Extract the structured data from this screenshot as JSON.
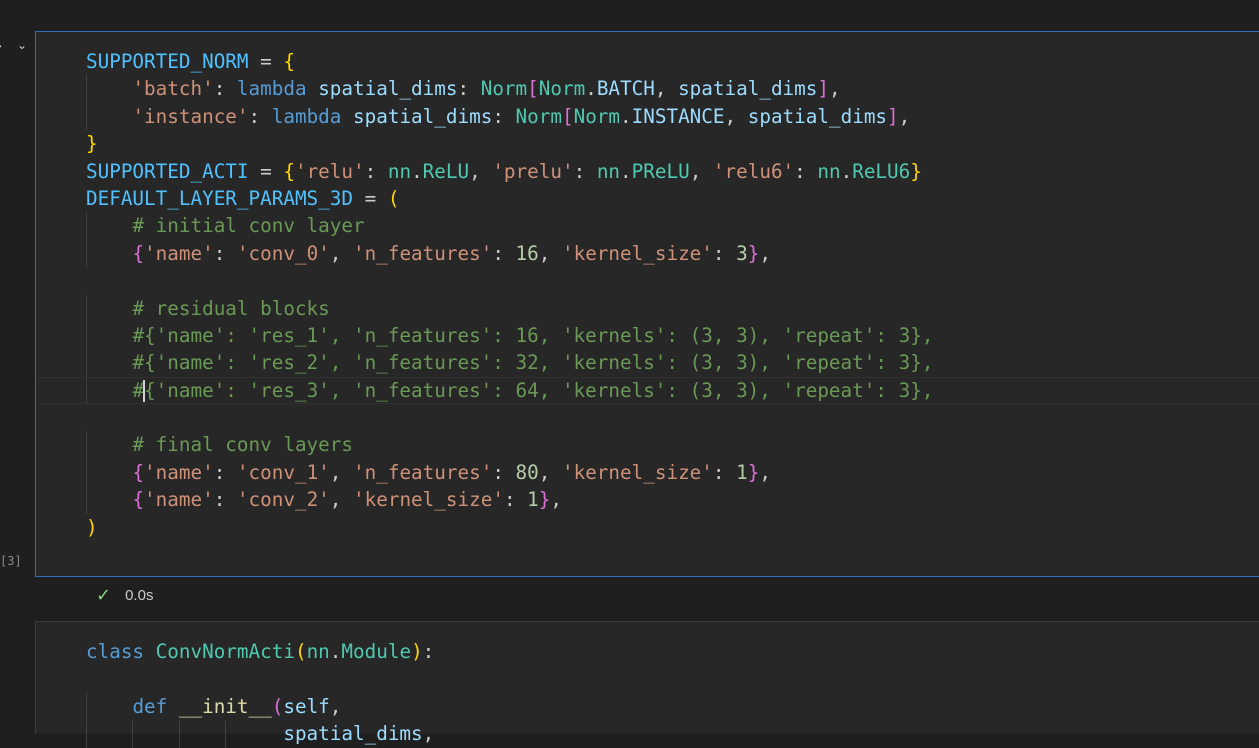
{
  "cell1": {
    "execution_count": "[3]",
    "status_time": "0.0s",
    "lines": [
      [
        [
          "t-var",
          "SUPPORTED_NORM"
        ],
        [
          "t-plain",
          " = "
        ],
        [
          "t-b1",
          "{"
        ]
      ],
      [
        [
          "t-plain",
          "    "
        ],
        [
          "t-str",
          "'batch'"
        ],
        [
          "t-plain",
          ": "
        ],
        [
          "t-kw",
          "lambda"
        ],
        [
          "t-plain",
          " "
        ],
        [
          "t-param",
          "spatial_dims"
        ],
        [
          "t-plain",
          ": "
        ],
        [
          "t-cls",
          "Norm"
        ],
        [
          "t-b2",
          "["
        ],
        [
          "t-cls",
          "Norm"
        ],
        [
          "t-plain",
          "."
        ],
        [
          "t-prop",
          "BATCH"
        ],
        [
          "t-plain",
          ", "
        ],
        [
          "t-param",
          "spatial_dims"
        ],
        [
          "t-b2",
          "]"
        ],
        [
          "t-plain",
          ","
        ]
      ],
      [
        [
          "t-plain",
          "    "
        ],
        [
          "t-str",
          "'instance'"
        ],
        [
          "t-plain",
          ": "
        ],
        [
          "t-kw",
          "lambda"
        ],
        [
          "t-plain",
          " "
        ],
        [
          "t-param",
          "spatial_dims"
        ],
        [
          "t-plain",
          ": "
        ],
        [
          "t-cls",
          "Norm"
        ],
        [
          "t-b2",
          "["
        ],
        [
          "t-cls",
          "Norm"
        ],
        [
          "t-plain",
          "."
        ],
        [
          "t-prop",
          "INSTANCE"
        ],
        [
          "t-plain",
          ", "
        ],
        [
          "t-param",
          "spatial_dims"
        ],
        [
          "t-b2",
          "]"
        ],
        [
          "t-plain",
          ","
        ]
      ],
      [
        [
          "t-b1",
          "}"
        ]
      ],
      [
        [
          "t-var",
          "SUPPORTED_ACTI"
        ],
        [
          "t-plain",
          " = "
        ],
        [
          "t-b1",
          "{"
        ],
        [
          "t-str",
          "'relu'"
        ],
        [
          "t-plain",
          ": "
        ],
        [
          "t-cls",
          "nn"
        ],
        [
          "t-plain",
          "."
        ],
        [
          "t-cls",
          "ReLU"
        ],
        [
          "t-plain",
          ", "
        ],
        [
          "t-str",
          "'prelu'"
        ],
        [
          "t-plain",
          ": "
        ],
        [
          "t-cls",
          "nn"
        ],
        [
          "t-plain",
          "."
        ],
        [
          "t-cls",
          "PReLU"
        ],
        [
          "t-plain",
          ", "
        ],
        [
          "t-str",
          "'relu6'"
        ],
        [
          "t-plain",
          ": "
        ],
        [
          "t-cls",
          "nn"
        ],
        [
          "t-plain",
          "."
        ],
        [
          "t-cls",
          "ReLU6"
        ],
        [
          "t-b1",
          "}"
        ]
      ],
      [
        [
          "t-var",
          "DEFAULT_LAYER_PARAMS_3D"
        ],
        [
          "t-plain",
          " = "
        ],
        [
          "t-b1",
          "("
        ]
      ],
      [
        [
          "t-plain",
          "    "
        ],
        [
          "t-com",
          "# initial conv layer"
        ]
      ],
      [
        [
          "t-plain",
          "    "
        ],
        [
          "t-b2",
          "{"
        ],
        [
          "t-str",
          "'name'"
        ],
        [
          "t-plain",
          ": "
        ],
        [
          "t-str",
          "'conv_0'"
        ],
        [
          "t-plain",
          ", "
        ],
        [
          "t-str",
          "'n_features'"
        ],
        [
          "t-plain",
          ": "
        ],
        [
          "t-num",
          "16"
        ],
        [
          "t-plain",
          ", "
        ],
        [
          "t-str",
          "'kernel_size'"
        ],
        [
          "t-plain",
          ": "
        ],
        [
          "t-num",
          "3"
        ],
        [
          "t-b2",
          "}"
        ],
        [
          "t-plain",
          ","
        ]
      ],
      [
        [
          "t-plain",
          ""
        ]
      ],
      [
        [
          "t-plain",
          "    "
        ],
        [
          "t-com",
          "# residual blocks"
        ]
      ],
      [
        [
          "t-plain",
          "    "
        ],
        [
          "t-com",
          "#{'name': 'res_1', 'n_features': 16, 'kernels': (3, 3), 'repeat': 3},"
        ]
      ],
      [
        [
          "t-plain",
          "    "
        ],
        [
          "t-com",
          "#{'name': 'res_2', 'n_features': 32, 'kernels': (3, 3), 'repeat': 3},"
        ]
      ],
      [
        [
          "t-plain",
          "    "
        ],
        [
          "t-com",
          "#"
        ],
        [
          "cursor",
          ""
        ],
        [
          "t-com",
          "{'name': 'res_3', 'n_features': 64, 'kernels': (3, 3), 'repeat': 3},"
        ]
      ],
      [
        [
          "t-plain",
          ""
        ]
      ],
      [
        [
          "t-plain",
          "    "
        ],
        [
          "t-com",
          "# final conv layers"
        ]
      ],
      [
        [
          "t-plain",
          "    "
        ],
        [
          "t-b2",
          "{"
        ],
        [
          "t-str",
          "'name'"
        ],
        [
          "t-plain",
          ": "
        ],
        [
          "t-str",
          "'conv_1'"
        ],
        [
          "t-plain",
          ", "
        ],
        [
          "t-str",
          "'n_features'"
        ],
        [
          "t-plain",
          ": "
        ],
        [
          "t-num",
          "80"
        ],
        [
          "t-plain",
          ", "
        ],
        [
          "t-str",
          "'kernel_size'"
        ],
        [
          "t-plain",
          ": "
        ],
        [
          "t-num",
          "1"
        ],
        [
          "t-b2",
          "}"
        ],
        [
          "t-plain",
          ","
        ]
      ],
      [
        [
          "t-plain",
          "    "
        ],
        [
          "t-b2",
          "{"
        ],
        [
          "t-str",
          "'name'"
        ],
        [
          "t-plain",
          ": "
        ],
        [
          "t-str",
          "'conv_2'"
        ],
        [
          "t-plain",
          ", "
        ],
        [
          "t-str",
          "'kernel_size'"
        ],
        [
          "t-plain",
          ": "
        ],
        [
          "t-num",
          "1"
        ],
        [
          "t-b2",
          "}"
        ],
        [
          "t-plain",
          ","
        ]
      ],
      [
        [
          "t-b1",
          ")"
        ]
      ]
    ]
  },
  "cell2": {
    "lines": [
      [
        [
          "t-kw",
          "class"
        ],
        [
          "t-plain",
          " "
        ],
        [
          "t-cls",
          "ConvNormActi"
        ],
        [
          "t-b1",
          "("
        ],
        [
          "t-cls",
          "nn"
        ],
        [
          "t-plain",
          "."
        ],
        [
          "t-cls",
          "Module"
        ],
        [
          "t-b1",
          ")"
        ],
        [
          "t-plain",
          ":"
        ]
      ],
      [
        [
          "t-plain",
          ""
        ]
      ],
      [
        [
          "t-plain",
          "    "
        ],
        [
          "t-kw",
          "def"
        ],
        [
          "t-plain",
          " "
        ],
        [
          "t-fn",
          "__init__"
        ],
        [
          "t-b2",
          "("
        ],
        [
          "t-param",
          "self"
        ],
        [
          "t-plain",
          ","
        ]
      ],
      [
        [
          "t-plain",
          "                 "
        ],
        [
          "t-param",
          "spatial_dims"
        ],
        [
          "t-plain",
          ","
        ]
      ]
    ]
  },
  "colors": {
    "background": "#1f1f1f",
    "cell_background": "#272727",
    "focus_border": "#2f6fb5",
    "success": "#89d185"
  },
  "icons": {
    "run": "run-cell-icon",
    "collapse": "chevron-down-icon",
    "success": "check-icon"
  }
}
